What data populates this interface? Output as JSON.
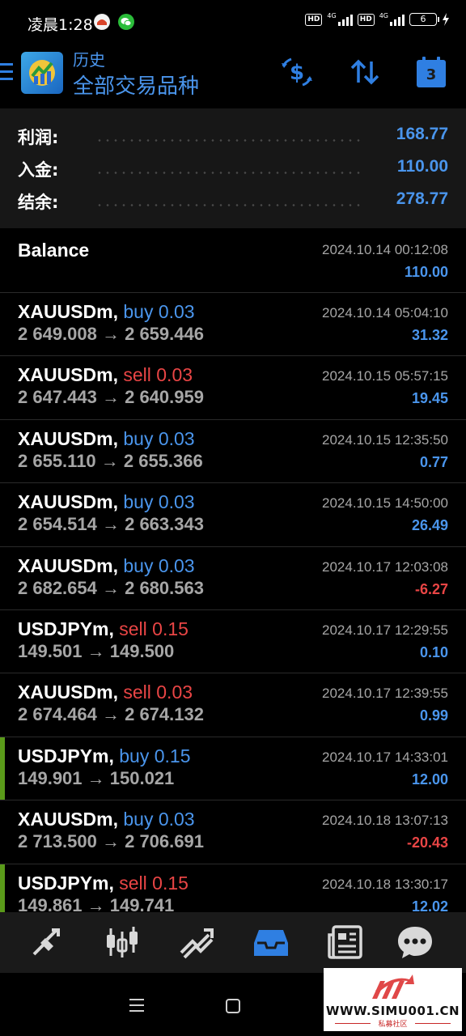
{
  "status_bar": {
    "time": "凌晨1:28",
    "hd1": "HD",
    "net1": "4G",
    "hd2": "HD",
    "net2": "4G",
    "battery": "6"
  },
  "header": {
    "subtitle": "历史",
    "title": "全部交易品种",
    "calendar_day": "3"
  },
  "summary": {
    "rows": [
      {
        "label": "利润:",
        "value": "168.77"
      },
      {
        "label": "入金:",
        "value": "110.00"
      },
      {
        "label": "结余:",
        "value": "278.77"
      }
    ]
  },
  "deals": [
    {
      "symbol": "Balance",
      "side": "",
      "side_class": "",
      "prices": "",
      "time": "2024.10.14 00:12:08",
      "profit": "110.00",
      "profit_class": "pos",
      "marked": false,
      "kind": "balance"
    },
    {
      "symbol": "XAUUSDm,",
      "side": "buy 0.03",
      "side_class": "side-buy",
      "prices": "2 649.008 → 2 659.446",
      "time": "2024.10.14 05:04:10",
      "profit": "31.32",
      "profit_class": "pos",
      "marked": false
    },
    {
      "symbol": "XAUUSDm,",
      "side": "sell 0.03",
      "side_class": "side-sell",
      "prices": "2 647.443 → 2 640.959",
      "time": "2024.10.15 05:57:15",
      "profit": "19.45",
      "profit_class": "pos",
      "marked": false
    },
    {
      "symbol": "XAUUSDm,",
      "side": "buy 0.03",
      "side_class": "side-buy",
      "prices": "2 655.110 → 2 655.366",
      "time": "2024.10.15 12:35:50",
      "profit": "0.77",
      "profit_class": "pos",
      "marked": false
    },
    {
      "symbol": "XAUUSDm,",
      "side": "buy 0.03",
      "side_class": "side-buy",
      "prices": "2 654.514 → 2 663.343",
      "time": "2024.10.15 14:50:00",
      "profit": "26.49",
      "profit_class": "pos",
      "marked": false
    },
    {
      "symbol": "XAUUSDm,",
      "side": "buy 0.03",
      "side_class": "side-buy",
      "prices": "2 682.654 → 2 680.563",
      "time": "2024.10.17 12:03:08",
      "profit": "-6.27",
      "profit_class": "neg",
      "marked": false
    },
    {
      "symbol": "USDJPYm,",
      "side": "sell 0.15",
      "side_class": "side-sell",
      "prices": "149.501 → 149.500",
      "time": "2024.10.17 12:29:55",
      "profit": "0.10",
      "profit_class": "pos",
      "marked": false
    },
    {
      "symbol": "XAUUSDm,",
      "side": "sell 0.03",
      "side_class": "side-sell",
      "prices": "2 674.464 → 2 674.132",
      "time": "2024.10.17 12:39:55",
      "profit": "0.99",
      "profit_class": "pos",
      "marked": false
    },
    {
      "symbol": "USDJPYm,",
      "side": "buy 0.15",
      "side_class": "side-buy",
      "prices": "149.901 → 150.021",
      "time": "2024.10.17 14:33:01",
      "profit": "12.00",
      "profit_class": "pos",
      "marked": true
    },
    {
      "symbol": "XAUUSDm,",
      "side": "buy 0.03",
      "side_class": "side-buy",
      "prices": "2 713.500 → 2 706.691",
      "time": "2024.10.18 13:07:13",
      "profit": "-20.43",
      "profit_class": "neg",
      "marked": false
    },
    {
      "symbol": "USDJPYm,",
      "side": "sell 0.15",
      "side_class": "side-sell",
      "prices": "149.861 → 149.741",
      "time": "2024.10.18 13:30:17",
      "profit": "12.02",
      "profit_class": "pos",
      "marked": true
    }
  ],
  "watermark": {
    "url": "WWW.SIMU001.CN",
    "sub": "私募社区"
  },
  "colors": {
    "accent_blue": "#4a95ec",
    "sell_red": "#e94545",
    "marker_green": "#5a9a1a"
  }
}
